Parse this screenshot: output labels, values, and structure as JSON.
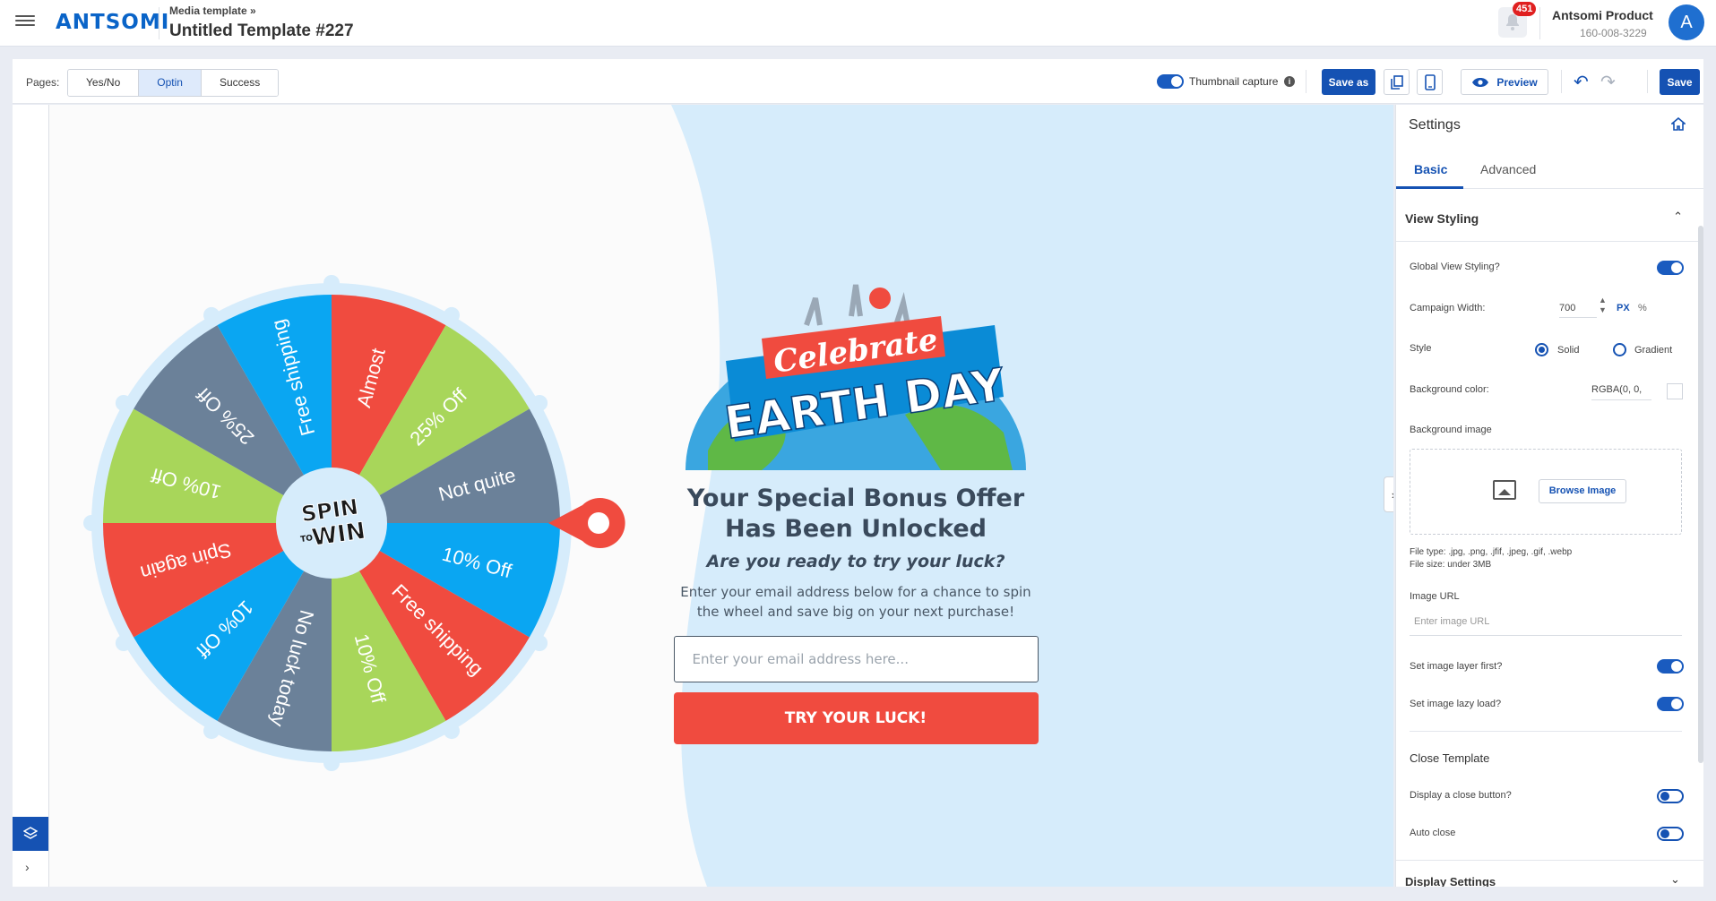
{
  "header": {
    "logo": "ANTSOMI",
    "breadcrumb": "Media template »",
    "title": "Untitled Template #227",
    "notification_count": "451",
    "account_name": "Antsomi Product",
    "account_id": "160-008-3229",
    "avatar_letter": "A"
  },
  "toolbar": {
    "pages_label": "Pages:",
    "pages": [
      "Yes/No",
      "Optin",
      "Success"
    ],
    "active_page": "Optin",
    "thumbnail_label": "Thumbnail capture",
    "save_as_label": "Save as",
    "preview_label": "Preview",
    "save_label": "Save"
  },
  "wheel": {
    "center_line1": "SPIN",
    "center_to": "TO",
    "center_line2": "WIN",
    "segments": [
      {
        "label": "Almost",
        "color": "#f04b3f"
      },
      {
        "label": "25% Off",
        "color": "#a8d65a"
      },
      {
        "label": "Not quite",
        "color": "#6b8199"
      },
      {
        "label": "10% Off",
        "color": "#0aa6f2"
      },
      {
        "label": "Free shipping",
        "color": "#f04b3f"
      },
      {
        "label": "10% Off",
        "color": "#a8d65a"
      },
      {
        "label": "No luck today",
        "color": "#6b8199"
      },
      {
        "label": "10% Off",
        "color": "#0aa6f2"
      },
      {
        "label": "Spin again",
        "color": "#f04b3f"
      },
      {
        "label": "10% Off",
        "color": "#a8d65a"
      },
      {
        "label": "25% Off",
        "color": "#6b8199"
      },
      {
        "label": "Free shipping",
        "color": "#0aa6f2"
      }
    ]
  },
  "offer": {
    "banner_line1": "Celebrate",
    "banner_line2": "EARTH DAY",
    "heading": "Your Special Bonus Offer Has Been Unlocked",
    "subheading": "Are you ready to try your luck?",
    "body": "Enter your email address below for a chance to spin the wheel and save big on your next purchase!",
    "email_placeholder": "Enter your email address here...",
    "cta": "TRY YOUR LUCK!"
  },
  "settings": {
    "title": "Settings",
    "tabs": [
      "Basic",
      "Advanced"
    ],
    "section_view": "View Styling",
    "global_view_styling": "Global View Styling?",
    "campaign_width_label": "Campaign Width:",
    "campaign_width_value": "700",
    "unit_px": "PX",
    "unit_pct": "%",
    "style_label": "Style",
    "style_solid": "Solid",
    "style_gradient": "Gradient",
    "bg_color_label": "Background color:",
    "bg_color_value": "RGBA(0, 0,",
    "bg_image_label": "Background image",
    "browse_label": "Browse Image",
    "file_type": "File type: .jpg, .png, .jfif, .jpeg, .gif, .webp",
    "file_size": "File size: under 3MB",
    "image_url_label": "Image URL",
    "image_url_placeholder": "Enter image URL",
    "image_layer_first": "Set image layer first?",
    "image_lazy_load": "Set image lazy load?",
    "close_template_label": "Close Template",
    "display_close_button": "Display a close button?",
    "auto_close": "Auto close",
    "display_settings": "Display Settings"
  },
  "colors": {
    "primary": "#1552b3",
    "cta": "#f04b3f",
    "canvas_blue": "#d6ecfb"
  }
}
